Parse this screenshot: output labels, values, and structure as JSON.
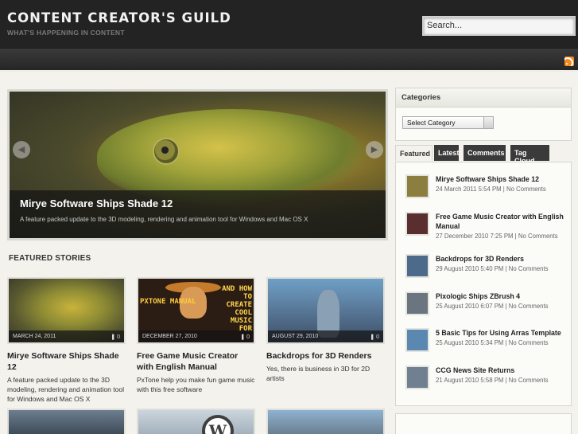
{
  "site": {
    "title": "CONTENT CREATOR'S GUILD",
    "tagline": "WHAT'S HAPPENING IN CONTENT"
  },
  "search": {
    "placeholder": "Search..."
  },
  "icons": {
    "rss": "rss-icon",
    "prev": "arrow-left-icon",
    "next": "arrow-right-icon",
    "comment": "comment-icon"
  },
  "slider": {
    "title": "Mirye Software Ships Shade 12",
    "text": "A feature packed update to the 3D modeling, rendering and animation tool for Windows and Mac OS X"
  },
  "featured": {
    "heading": "FEATURED STORIES",
    "cards": [
      {
        "date": "MARCH 24, 2011",
        "comments": "0",
        "title": "Mirye Software Ships Shade 12",
        "excerpt": "A feature packed update to the 3D modeling, rendering and animation tool for Windows and Mac OS X"
      },
      {
        "date": "DECEMBER 27, 2010",
        "comments": "0",
        "title": "Free Game Music Creator with English Manual",
        "excerpt": "PxTone help you make fun game music with this free software"
      },
      {
        "date": "AUGUST 29, 2010",
        "comments": "0",
        "title": "Backdrops for 3D Renders",
        "excerpt": "Yes, there is business in 3D for 2D artists"
      }
    ],
    "card2_art": {
      "left": "PXTONE MANUAL",
      "right": "AND HOW TO CREATE COOL MUSIC FOR"
    },
    "wordpress_logo": "W"
  },
  "sidebar": {
    "categories": {
      "heading": "Categories",
      "select_value": "Select Category"
    },
    "tabs": [
      "Featured",
      "Latest",
      "Comments",
      "Tag Cloud"
    ],
    "posts": [
      {
        "title": "Mirye Software Ships Shade 12",
        "date": "24 March 2011 5:54 PM | No Comments"
      },
      {
        "title": "Free Game Music Creator with English Manual",
        "date": "27 December 2010 7:25 PM | No Comments"
      },
      {
        "title": "Backdrops for 3D Renders",
        "date": "29 August 2010 5:40 PM | No Comments"
      },
      {
        "title": "Pixologic Ships ZBrush 4",
        "date": "25 August 2010 6:07 PM | No Comments"
      },
      {
        "title": "5 Basic Tips for Using Arras Template",
        "date": "25 August 2010 5:34 PM | No Comments"
      },
      {
        "title": "CCG News Site Returns",
        "date": "21 August 2010 5:58 PM | No Comments"
      }
    ]
  }
}
